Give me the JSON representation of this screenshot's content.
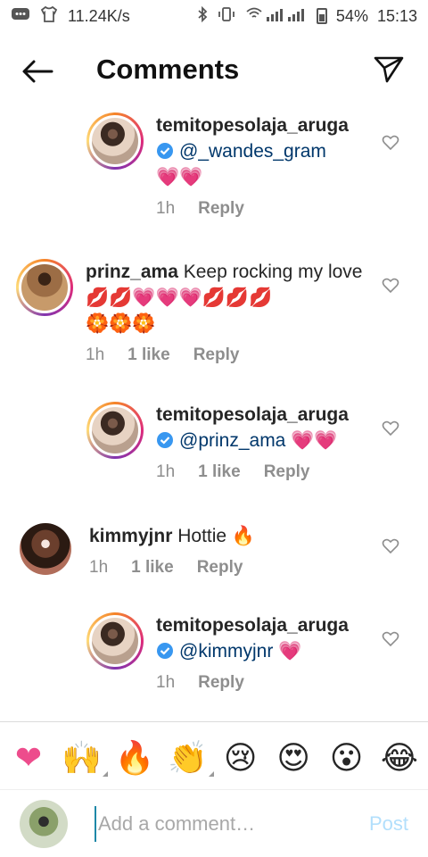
{
  "status_bar": {
    "speed": "11.24K/s",
    "battery": "54%",
    "time": "15:13"
  },
  "header": {
    "title": "Comments"
  },
  "comments": [
    {
      "username": "temitopesolaja_aruga",
      "mention": "@_wandes_gram",
      "emojis": "💗💗",
      "time": "1h",
      "reply_label": "Reply"
    },
    {
      "username": "prinz_ama",
      "text": "Keep rocking my love",
      "emojis": "💋💋💗💗💗💋💋💋",
      "emojis2": "🏵️🏵️🏵️",
      "time": "1h",
      "likes": "1 like",
      "reply_label": "Reply"
    },
    {
      "username": "temitopesolaja_aruga",
      "mention": "@prinz_ama",
      "emojis": "💗💗",
      "time": "1h",
      "likes": "1 like",
      "reply_label": "Reply"
    },
    {
      "username": "kimmyjnr",
      "text": "Hottie",
      "emojis": "🔥",
      "time": "1h",
      "likes": "1 like",
      "reply_label": "Reply"
    },
    {
      "username": "temitopesolaja_aruga",
      "mention": "@kimmyjnr",
      "emojis": "💗",
      "time": "1h",
      "reply_label": "Reply"
    }
  ],
  "reactions": [
    "❤",
    "🙌",
    "🔥",
    "👏",
    "😢",
    "😍",
    "😮",
    "😂"
  ],
  "composer": {
    "placeholder": "Add a comment…",
    "post_label": "Post"
  },
  "colors": {
    "accent": "#0095f6",
    "mention": "#00376b",
    "muted": "#8e8e8e",
    "verified": "#3897f0"
  }
}
